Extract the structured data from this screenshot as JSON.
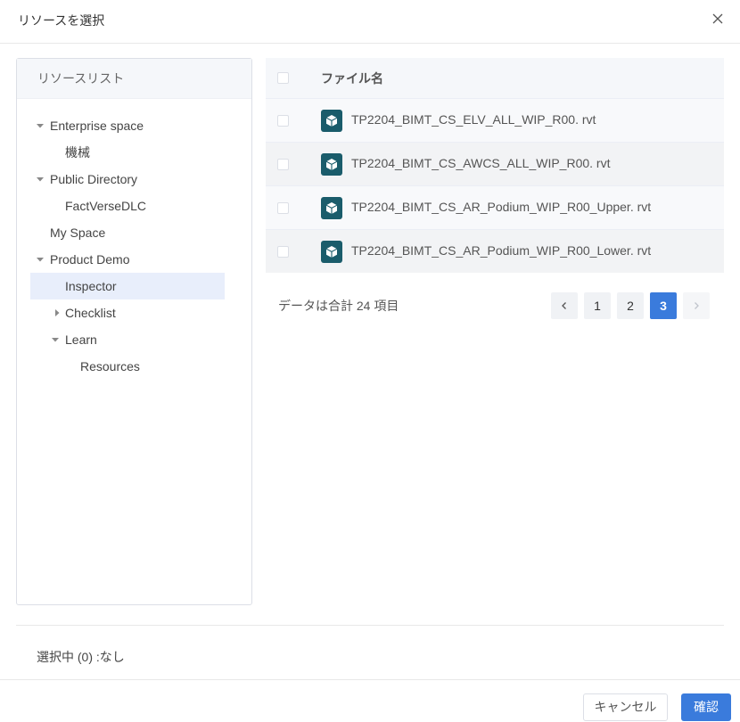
{
  "dialog": {
    "title": "リソースを選択"
  },
  "tree": {
    "header": "リソースリスト",
    "nodes": [
      {
        "label": "Enterprise space",
        "level": 1,
        "arrow": "down"
      },
      {
        "label": "機械",
        "level": 2,
        "arrow": "none"
      },
      {
        "label": "Public Directory",
        "level": 1,
        "arrow": "down"
      },
      {
        "label": "FactVerseDLC",
        "level": 2,
        "arrow": "none"
      },
      {
        "label": "My Space",
        "level": 1,
        "arrow": "none"
      },
      {
        "label": "Product Demo",
        "level": 1,
        "arrow": "down"
      },
      {
        "label": "Inspector",
        "level": 2,
        "arrow": "none",
        "selected": true
      },
      {
        "label": "Checklist",
        "level": 2,
        "arrow": "right"
      },
      {
        "label": "Learn",
        "level": 2,
        "arrow": "down"
      },
      {
        "label": "Resources",
        "level": 3,
        "arrow": "none"
      }
    ]
  },
  "table": {
    "column_header": "ファイル名",
    "rows": [
      {
        "name": "TP2204_BIMT_CS_ELV_ALL_WIP_R00. rvt",
        "icon": "model-file-icon"
      },
      {
        "name": "TP2204_BIMT_CS_AWCS_ALL_WIP_R00. rvt",
        "icon": "model-file-icon"
      },
      {
        "name": "TP2204_BIMT_CS_AR_Podium_WIP_R00_Upper. rvt",
        "icon": "model-file-icon"
      },
      {
        "name": "TP2204_BIMT_CS_AR_Podium_WIP_R00_Lower. rvt",
        "icon": "model-file-icon"
      }
    ]
  },
  "pagination": {
    "total_text": "データは合計 24 項目",
    "pages": [
      "1",
      "2",
      "3"
    ],
    "current_page": "3"
  },
  "selection": {
    "text": "選択中 (0) :なし"
  },
  "footer": {
    "cancel_label": "キャンセル",
    "confirm_label": "確認"
  },
  "colors": {
    "accent": "#3a7bdc",
    "file_icon": "#1a5c6b",
    "selected_bg": "#e8eefb"
  }
}
